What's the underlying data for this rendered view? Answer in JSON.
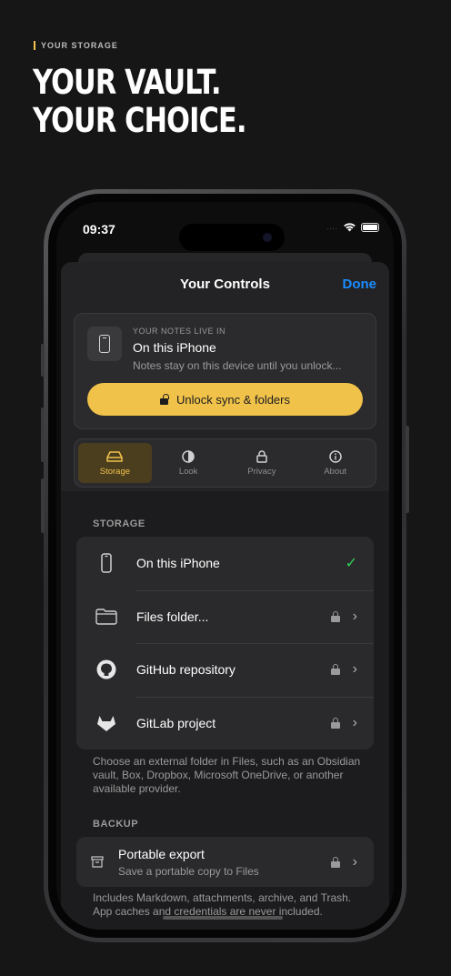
{
  "promo": {
    "eyebrow": "YOUR STORAGE",
    "headline_line1": "YOUR VAULT.",
    "headline_line2": "YOUR CHOICE.",
    "accent_color": "#f0c24a"
  },
  "status_bar": {
    "time": "09:37",
    "cellular": "....",
    "icons": [
      "wifi-icon",
      "battery-icon"
    ]
  },
  "sheet": {
    "title": "Your Controls",
    "done_label": "Done"
  },
  "notes_location": {
    "kicker": "YOUR NOTES LIVE IN",
    "place": "On this iPhone",
    "description": "Notes stay on this device until you unlock...",
    "unlock_label": "Unlock sync & folders"
  },
  "tabs": [
    {
      "label": "Storage",
      "icon": "drive-icon",
      "active": true
    },
    {
      "label": "Look",
      "icon": "contrast-icon",
      "active": false
    },
    {
      "label": "Privacy",
      "icon": "lock-icon",
      "active": false
    },
    {
      "label": "About",
      "icon": "info-icon",
      "active": false
    }
  ],
  "storage": {
    "section_label": "STORAGE",
    "options": [
      {
        "label": "On this iPhone",
        "icon": "iphone-icon",
        "selected": true,
        "locked": false
      },
      {
        "label": "Files folder...",
        "icon": "folder-icon",
        "selected": false,
        "locked": true
      },
      {
        "label": "GitHub repository",
        "icon": "github-icon",
        "selected": false,
        "locked": true
      },
      {
        "label": "GitLab project",
        "icon": "gitlab-icon",
        "selected": false,
        "locked": true
      }
    ],
    "footnote": "Choose an external folder in Files, such as an Obsidian vault, Box, Dropbox, Microsoft OneDrive, or another available provider."
  },
  "backup": {
    "section_label": "BACKUP",
    "title": "Portable export",
    "subtitle": "Save a portable copy to Files",
    "footnote": "Includes Markdown, attachments, archive, and Trash. App caches and credentials are never included."
  }
}
